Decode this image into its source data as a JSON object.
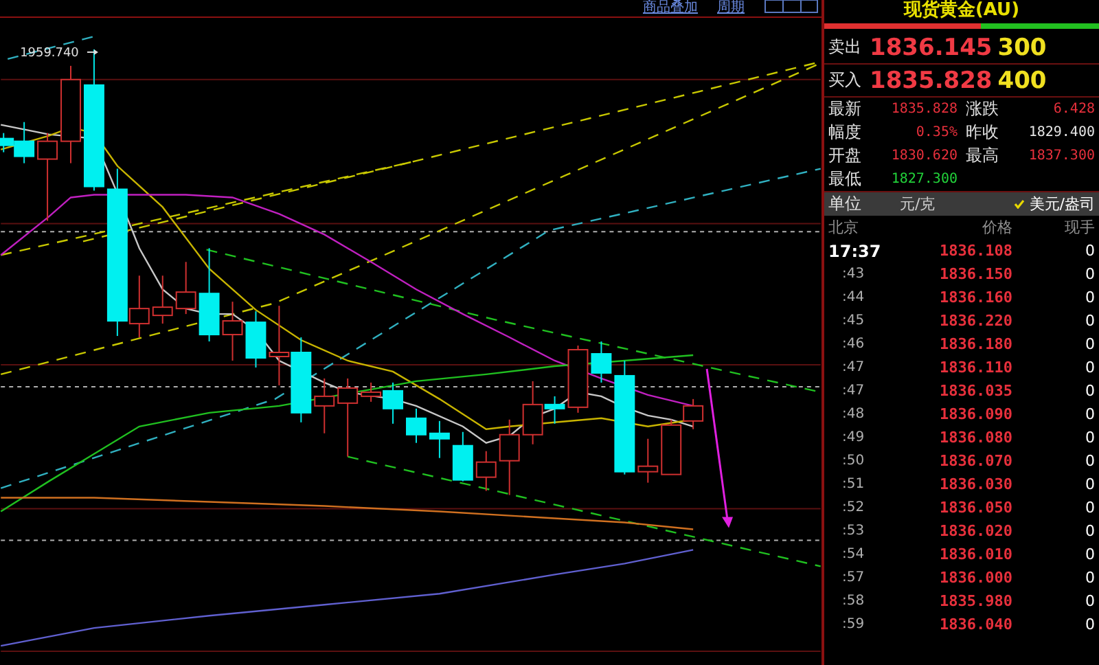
{
  "top_links": [
    {
      "label": "商品叠加"
    },
    {
      "label": "周期"
    }
  ],
  "chart": {
    "high_label": "1959.740"
  },
  "panel": {
    "title": "现货黄金(AU)",
    "ratio_bar": {
      "level": 0.57
    },
    "quotes": [
      {
        "label": "卖出",
        "price": "1836.145",
        "volume": "300"
      },
      {
        "label": "买入",
        "price": "1835.828",
        "volume": "400"
      }
    ],
    "stats": [
      {
        "label": "最新",
        "value": "1835.828",
        "color": "#e8303c"
      },
      {
        "label": "涨跌",
        "value": "6.428",
        "color": "#e8303c"
      },
      {
        "label": "幅度",
        "value": "0.35%",
        "color": "#e8303c"
      },
      {
        "label": "昨收",
        "value": "1829.400",
        "color": "#e6e6e6"
      },
      {
        "label": "开盘",
        "value": "1830.620",
        "color": "#e8303c"
      },
      {
        "label": "最高",
        "value": "1837.300",
        "color": "#e8303c"
      },
      {
        "label": "最低",
        "value": "1827.300",
        "color": "#22d33a"
      }
    ],
    "units": {
      "label": "单位",
      "options": [
        {
          "label": "元/克",
          "selected": false
        },
        {
          "label": "美元/盎司",
          "selected": true
        }
      ]
    },
    "ticks": {
      "columns": [
        "北京",
        "价格",
        "现手"
      ],
      "rows": [
        {
          "time": "17:37",
          "kind": "full",
          "price": "1836.108",
          "volume": "0"
        },
        {
          "time": ":43",
          "kind": "minute",
          "price": "1836.150",
          "volume": "0"
        },
        {
          "time": ":44",
          "kind": "minute",
          "price": "1836.160",
          "volume": "0"
        },
        {
          "time": ":45",
          "kind": "minute",
          "price": "1836.220",
          "volume": "0"
        },
        {
          "time": ":46",
          "kind": "minute",
          "price": "1836.180",
          "volume": "0"
        },
        {
          "time": ":47",
          "kind": "minute",
          "price": "1836.110",
          "volume": "0"
        },
        {
          "time": ":47",
          "kind": "minute",
          "price": "1836.035",
          "volume": "0"
        },
        {
          "time": ":48",
          "kind": "minute",
          "price": "1836.090",
          "volume": "0"
        },
        {
          "time": ":49",
          "kind": "minute",
          "price": "1836.080",
          "volume": "0"
        },
        {
          "time": ":50",
          "kind": "minute",
          "price": "1836.070",
          "volume": "0"
        },
        {
          "time": ":51",
          "kind": "minute",
          "price": "1836.030",
          "volume": "0"
        },
        {
          "time": ":52",
          "kind": "minute",
          "price": "1836.050",
          "volume": "0"
        },
        {
          "time": ":53",
          "kind": "minute",
          "price": "1836.020",
          "volume": "0"
        },
        {
          "time": ":54",
          "kind": "minute",
          "price": "1836.010",
          "volume": "0"
        },
        {
          "time": ":57",
          "kind": "minute",
          "price": "1836.000",
          "volume": "0"
        },
        {
          "time": ":58",
          "kind": "minute",
          "price": "1835.980",
          "volume": "0"
        },
        {
          "time": ":59",
          "kind": "minute",
          "price": "1836.040",
          "volume": "0"
        }
      ]
    }
  }
}
